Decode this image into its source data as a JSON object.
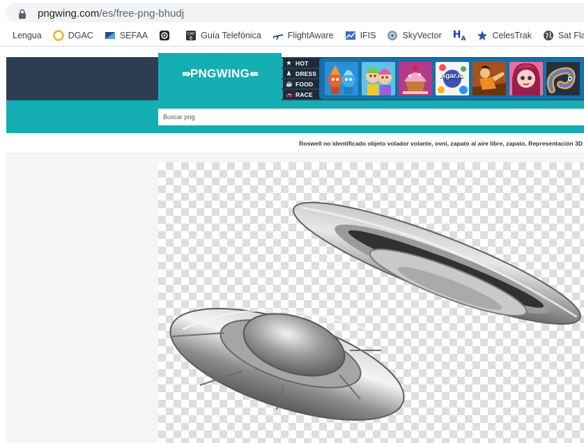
{
  "browser": {
    "url_host": "pngwing.com",
    "url_path": "/es/free-png-bhudj"
  },
  "bookmarks": [
    {
      "label": "Lengua",
      "icon": "none"
    },
    {
      "label": "DGAC",
      "icon": "circle-yellow-icon"
    },
    {
      "label": "SEFAA",
      "icon": "flag-icon"
    },
    {
      "label": "",
      "icon": "camera-icon"
    },
    {
      "label": "Guía Telefónica",
      "icon": "cap6-icon"
    },
    {
      "label": "FlightAware",
      "icon": "airplane-icon"
    },
    {
      "label": "IFIS",
      "icon": "chart-icon"
    },
    {
      "label": "SkyVector",
      "icon": "globe-icon"
    },
    {
      "label": "CelesTrak",
      "icon": "star-icon"
    },
    {
      "label": "Sat Flare",
      "icon": "world-icon"
    }
  ],
  "bookmark_badges": {
    "ha": "H",
    "ha_sub": "A"
  },
  "site": {
    "logo": "PNGWING",
    "categories": [
      {
        "label": "HOT",
        "icon": "★"
      },
      {
        "label": "DRESS",
        "icon": "♟"
      },
      {
        "label": "FOOD",
        "icon": "☕"
      },
      {
        "label": "RACE",
        "icon": "🚗"
      }
    ],
    "games": [
      {
        "name": "game-thumb-fireboy-watergirl",
        "color": "#e8652b"
      },
      {
        "name": "game-thumb-dress-up",
        "color": "#7ac943"
      },
      {
        "name": "game-thumb-cupcake",
        "color": "#f48fb1"
      },
      {
        "name": "game-thumb-agario",
        "color": "#ffffff",
        "label": "Agar.io"
      },
      {
        "name": "game-thumb-fighter",
        "color": "#d9822b"
      },
      {
        "name": "game-thumb-princess",
        "color": "#e57399"
      },
      {
        "name": "game-thumb-slither",
        "color": "#5a7fd1"
      }
    ],
    "search_placeholder": "Buscar png",
    "description": "Roswell no identificado objeto volador volante, ovni, zapato al aire libre, zapato, Representación 3D"
  },
  "colors": {
    "teal": "#14aeb3",
    "navy": "#2d3e52",
    "game_blue": "#1571a8"
  }
}
